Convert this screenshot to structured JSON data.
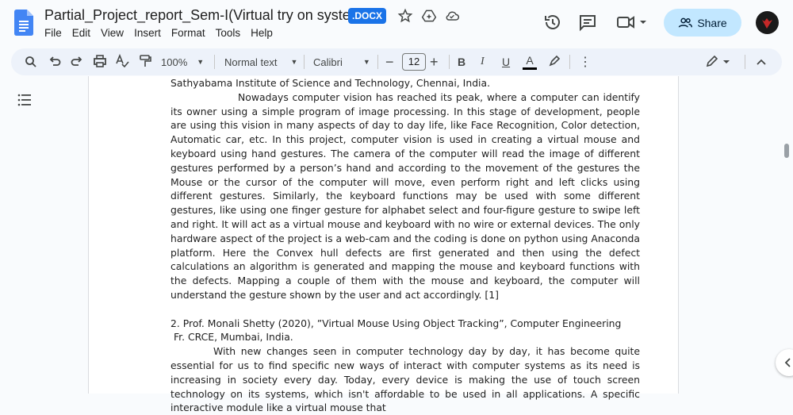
{
  "document": {
    "title": "Partial_Project_report_Sem-I(Virtual try on system)",
    "format_badge": ".DOCX"
  },
  "menu": [
    "File",
    "Edit",
    "View",
    "Insert",
    "Format",
    "Tools",
    "Help"
  ],
  "share": {
    "label": "Share"
  },
  "toolbar": {
    "zoom": "100%",
    "style": "Normal text",
    "font": "Calibri",
    "font_size": "12",
    "bold": "B",
    "italic": "I",
    "underline": "U",
    "text_color": "A"
  },
  "content": {
    "line0": "Sathyabama Institute of Science and Technology, Chennai, India.",
    "para1": "Nowadays computer vision has reached its peak, where a computer can identify its owner using a simple program of image processing. In this stage of development, people are using this vision in many aspects of day to day life, like Face Recognition, Color detection, Automatic car, etc. In this project, computer vision is used in creating a virtual mouse and keyboard using hand gestures. The camera of the computer will read the image of different gestures performed by a person’s hand and according to the movement of the gestures the Mouse or the cursor of the computer will move, even perform right and left clicks using different gestures. Similarly, the keyboard functions may be used with some different gestures, like using one finger gesture for alphabet select and four-figure gesture to swipe left and right. It will act as a virtual mouse and keyboard with no wire or external devices. The only hardware aspect of the project is a web-cam and the coding is done on python using Anaconda platform. Here the Convex hull defects are first generated and then using the defect calculations an algorithm is generated and mapping the mouse and keyboard functions with the defects. Mapping a couple of them with the mouse and keyboard, the computer will understand the gesture shown by the user and act accordingly. [1]",
    "ref2_line1": "2.  Prof. Monali Shetty (2020), ”Virtual Mouse Using Object Tracking”, Computer Engineering",
    "ref2_line2": " Fr. CRCE, Mumbai, India.",
    "para2": "With new changes seen in computer technology day by day, it has become quite essential for us to find specific new ways of interact with computer systems as its need is increasing in society every day. Today, every device is making the use of touch screen technology on its systems, which isn't affordable to be used in all applications. A specific interactive module like a virtual mouse that"
  },
  "colors": {
    "accent": "#1a73e8",
    "share_bg": "#c2e7ff",
    "toolbar_bg": "#edf2fa"
  }
}
